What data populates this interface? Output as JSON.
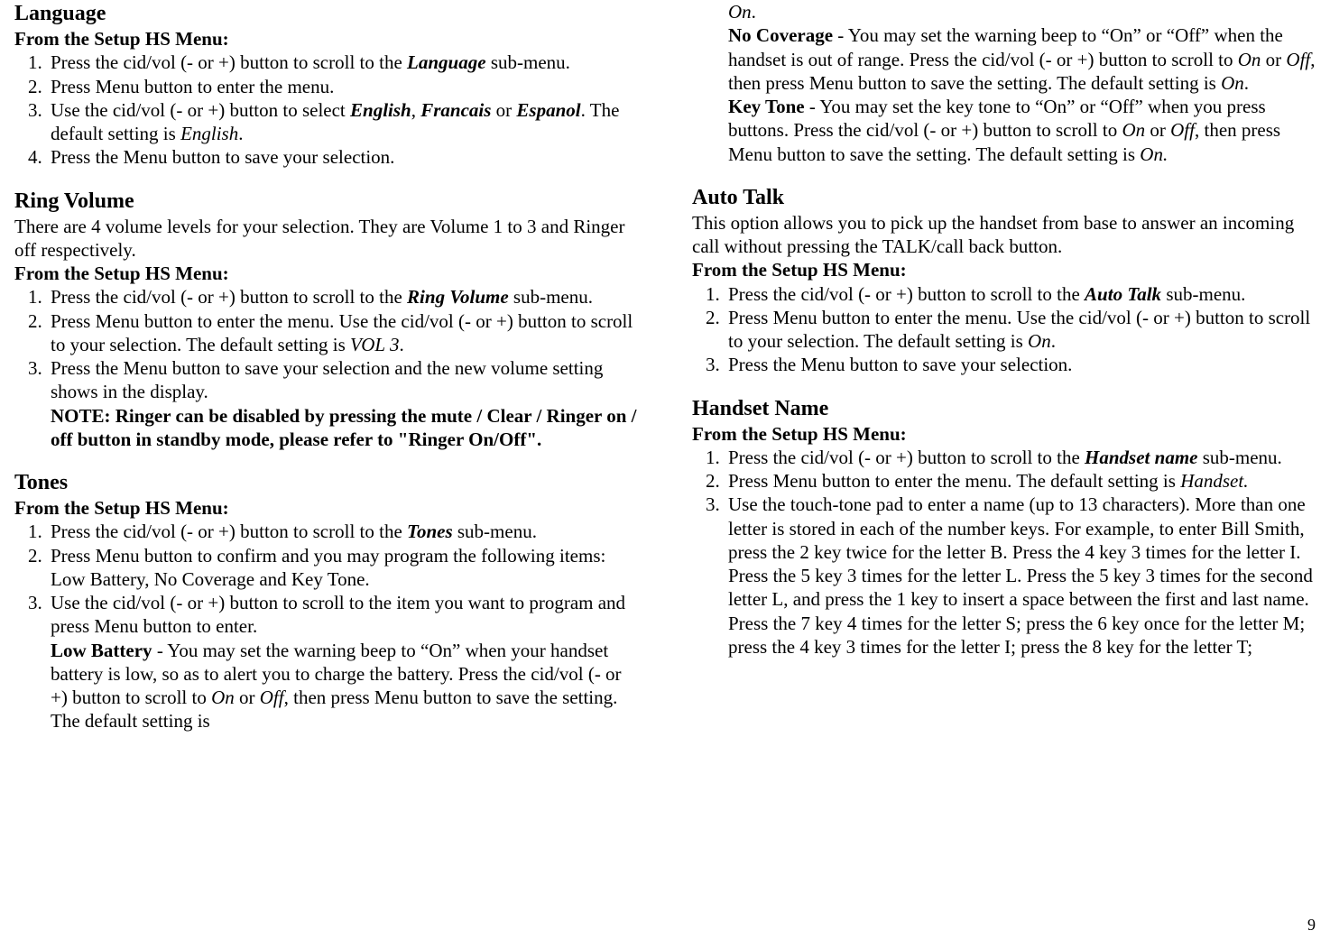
{
  "left": {
    "language_h": "Language",
    "from_setup": "From the Setup HS Menu:",
    "lang_1a": "Press the cid/vol (- or +) button to scroll to the ",
    "lang_1b": "Language",
    "lang_1c": " sub-menu.",
    "lang_2": "Press Menu button to enter the menu.",
    "lang_3a": "Use the cid/vol (- or +) button to select ",
    "lang_3b": "English",
    "lang_3c": ", ",
    "lang_3d": "Francais",
    "lang_3e": " or ",
    "lang_3f": "Espanol",
    "lang_3g": ". The default setting is ",
    "lang_3h": "English",
    "lang_3i": ".",
    "lang_4": "Press the Menu button to save your selection.",
    "ring_h": "Ring Volume",
    "ring_intro": "There are 4 volume levels for your selection. They are Volume 1 to 3 and Ringer off respectively.",
    "ring_1a": "Press the cid/vol (- or +) button to scroll to the ",
    "ring_1b": "Ring Volume",
    "ring_1c": " sub-menu.",
    "ring_2a": "Press Menu button to enter the menu. Use the cid/vol (- or +) button to scroll to your selection. The default setting is ",
    "ring_2b": "VOL 3",
    "ring_2c": ".",
    "ring_3": "Press the Menu button to save your selection and the new volume setting shows in the display.",
    "ring_note": "NOTE: Ringer can be disabled by pressing the mute / Clear / Ringer on / off button in standby mode, please refer to \"Ringer On/Off\".",
    "tones_h": "Tones",
    "tones_1a": "Press the cid/vol (- or +) button to scroll to the ",
    "tones_1b": "Tones",
    "tones_1c": " sub-menu.",
    "tones_2": "Press Menu button to confirm and you may program the following items: Low Battery, No Coverage and Key Tone.",
    "tones_3": "Use the cid/vol (- or +) button to scroll to the item you want to program and press Menu button to enter.",
    "lowbat_label": "Low Battery",
    "lowbat_text_a": " - You may set the warning beep to “On” when your handset battery is low, so as to alert you to charge the battery. Press the cid/vol (- or +) button to scroll to ",
    "lowbat_text_on": "On",
    "lowbat_text_or": " or ",
    "lowbat_text_off": "Off",
    "lowbat_text_b": ", then press Menu button to save the setting. The default setting is"
  },
  "right": {
    "on_cont": "On",
    "on_dot": ".",
    "nocov_label": "No Coverage",
    "nocov_a": " - You may set the warning beep to “On” or “Off” when the handset is out of range. Press the cid/vol (- or +) button to scroll to ",
    "nocov_on": "On",
    "nocov_or": " or ",
    "nocov_off": "Off",
    "nocov_b": ", then press Menu button to save the setting. The default setting is ",
    "nocov_def": "On",
    "nocov_dot": ".",
    "key_label": "Key Tone",
    "key_a": " - You may set the key tone to “On” or “Off” when you press buttons. Press the cid/vol (- or +) button to scroll to ",
    "key_on": "On",
    "key_or": " or ",
    "key_off": "Off",
    "key_b": ", then press Menu button to save the setting. The default setting is ",
    "key_def": "On.",
    "auto_h": "Auto Talk",
    "auto_intro": "This option allows you to pick up the handset from base to answer an incoming call without pressing the TALK/call back button.",
    "from_setup": "From the Setup HS Menu:",
    "auto_1a": "Press the cid/vol (- or +) button to scroll to the ",
    "auto_1b": "Auto Talk",
    "auto_1c": " sub-menu.",
    "auto_2a": "Press Menu button to enter the menu. Use the cid/vol (- or +) button to scroll to your selection. The default setting is ",
    "auto_2b": "On",
    "auto_2c": ".",
    "auto_3": "Press the Menu button to save your selection.",
    "hs_h": "Handset Name",
    "hs_1a": "Press the cid/vol (- or +) button to scroll to the ",
    "hs_1b": "Handset name",
    "hs_1c": " sub-menu.",
    "hs_2a": "Press Menu button to enter the menu. The default setting is ",
    "hs_2b": "Handset.",
    "hs_3": "Use the touch-tone pad to enter a name (up to 13 characters). More than one letter is stored in each of the number keys. For example, to enter Bill Smith, press the 2 key twice for the letter B. Press the 4 key 3 times for the letter I. Press the 5 key 3 times for the letter L. Press the 5 key 3 times for the second letter L, and press the 1 key to insert a space between the first and last name. Press the 7 key 4 times for the letter S; press the 6 key once for the letter M; press the 4 key 3 times for the letter I; press the 8 key for the letter T;"
  },
  "pagenum": "9"
}
